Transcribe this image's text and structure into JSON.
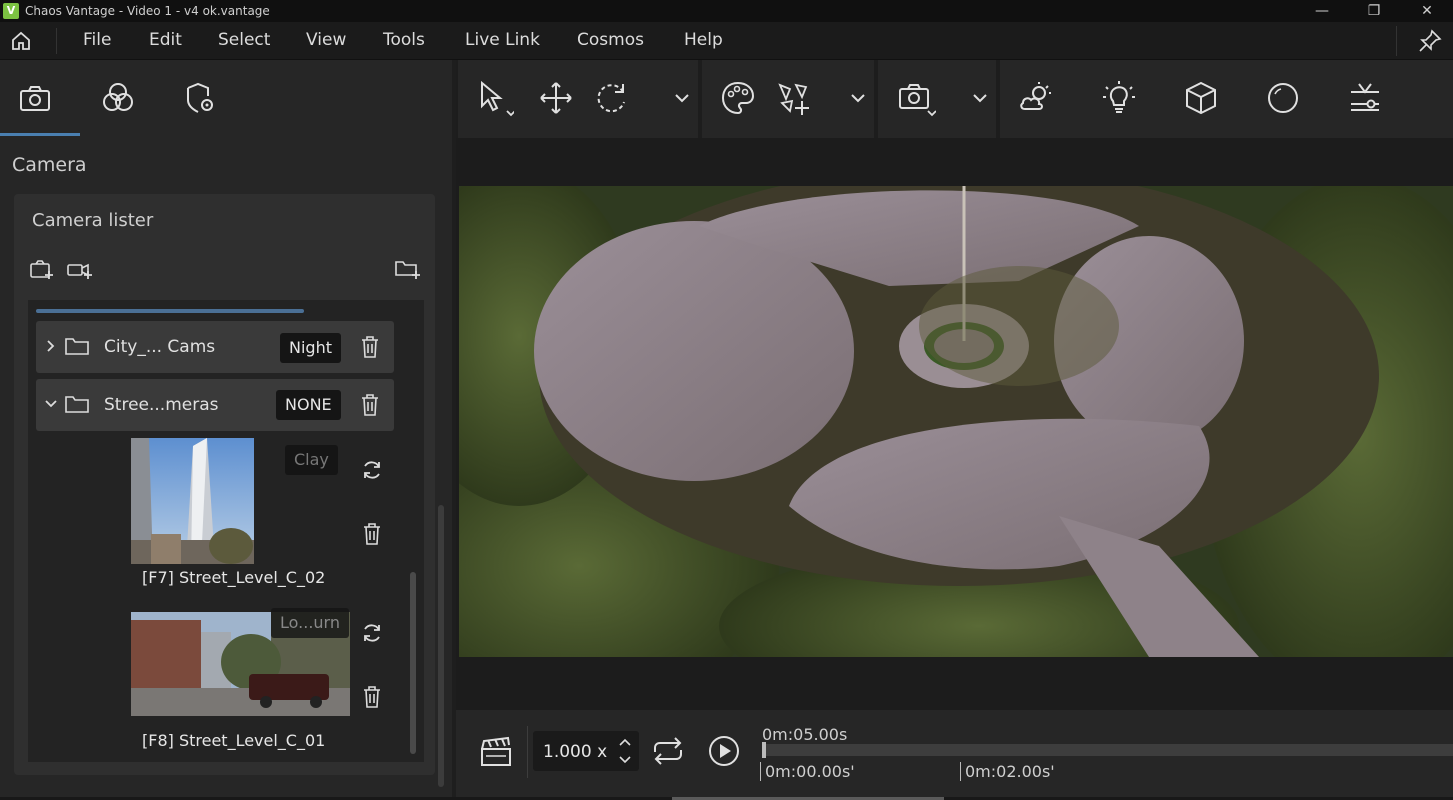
{
  "window": {
    "title": "Chaos Vantage - Video 1 - v4 ok.vantage",
    "logo_text": "V",
    "minimize": "—",
    "maximize": "❐",
    "close": "✕"
  },
  "menu": {
    "items": [
      "File",
      "Edit",
      "Select",
      "View",
      "Tools",
      "Live Link",
      "Cosmos",
      "Help"
    ]
  },
  "left_panel": {
    "section_label": "Camera",
    "lister_title": "Camera lister",
    "folders": [
      {
        "name": "City_... Cams",
        "tag": "Night",
        "expanded": false
      },
      {
        "name": "Stree...meras",
        "tag": "NONE",
        "expanded": true
      }
    ],
    "cameras": [
      {
        "name": "[F7] Street_Level_C_02",
        "tag": "Clay"
      },
      {
        "name": "[F8] Street_Level_C_01",
        "tag": "Lo...urn"
      }
    ]
  },
  "toolbar": {
    "icons": [
      "select-icon",
      "move-icon",
      "rotate-icon",
      "chevron-down-icon",
      "material-palette-icon",
      "scatter-add-icon",
      "chevron-down-icon",
      "camera-icon",
      "chevron-down-icon",
      "weather-icon",
      "light-bulb-icon",
      "cube-icon",
      "sphere-icon",
      "settings-sliders-icon"
    ]
  },
  "timeline": {
    "speed": "1.000 x",
    "duration": "0m:05.00s",
    "marker_start": "0m:00.00s'",
    "marker_2": "0m:02.00s'"
  },
  "colors": {
    "accent": "#4a7fb0",
    "panel": "#262626",
    "logo": "#7cc242"
  }
}
